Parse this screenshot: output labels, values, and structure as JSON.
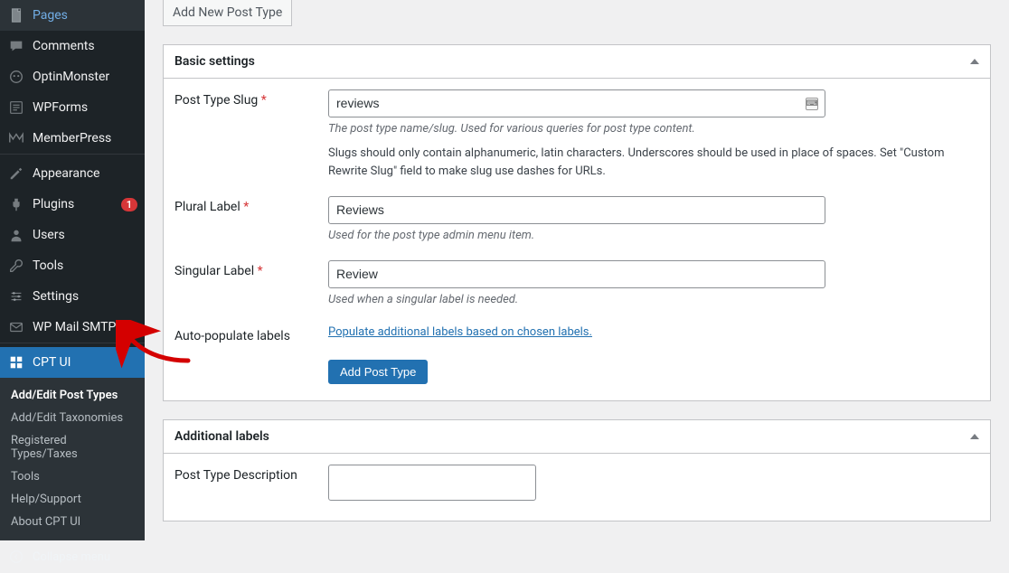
{
  "sidebar": {
    "items": [
      {
        "label": "Pages",
        "icon": "pages"
      },
      {
        "label": "Comments",
        "icon": "comments"
      },
      {
        "label": "OptinMonster",
        "icon": "optin"
      },
      {
        "label": "WPForms",
        "icon": "wpforms"
      },
      {
        "label": "MemberPress",
        "icon": "memberpress"
      },
      {
        "label": "Appearance",
        "icon": "appearance"
      },
      {
        "label": "Plugins",
        "icon": "plugins",
        "badge": "1"
      },
      {
        "label": "Users",
        "icon": "users"
      },
      {
        "label": "Tools",
        "icon": "tools"
      },
      {
        "label": "Settings",
        "icon": "settings"
      },
      {
        "label": "WP Mail SMTP",
        "icon": "mail"
      }
    ],
    "active": {
      "label": "CPT UI",
      "icon": "cptui"
    },
    "submenu": [
      {
        "label": "Add/Edit Post Types",
        "current": true
      },
      {
        "label": "Add/Edit Taxonomies"
      },
      {
        "label": "Registered Types/Taxes"
      },
      {
        "label": "Tools"
      },
      {
        "label": "Help/Support"
      },
      {
        "label": "About CPT UI"
      }
    ],
    "collapse": "Collapse menu"
  },
  "tabs": {
    "add_new": "Add New Post Type"
  },
  "panel_basic": {
    "title": "Basic settings",
    "slug": {
      "label": "Post Type Slug",
      "value": "reviews",
      "help": "The post type name/slug. Used for various queries for post type content.",
      "desc": "Slugs should only contain alphanumeric, latin characters. Underscores should be used in place of spaces. Set \"Custom Rewrite Slug\" field to make slug use dashes for URLs."
    },
    "plural": {
      "label": "Plural Label",
      "value": "Reviews",
      "help": "Used for the post type admin menu item."
    },
    "singular": {
      "label": "Singular Label",
      "value": "Review",
      "help": "Used when a singular label is needed."
    },
    "auto": {
      "label": "Auto-populate labels",
      "link": "Populate additional labels based on chosen labels."
    },
    "submit": "Add Post Type"
  },
  "panel_additional": {
    "title": "Additional labels",
    "desc_label": "Post Type Description"
  }
}
